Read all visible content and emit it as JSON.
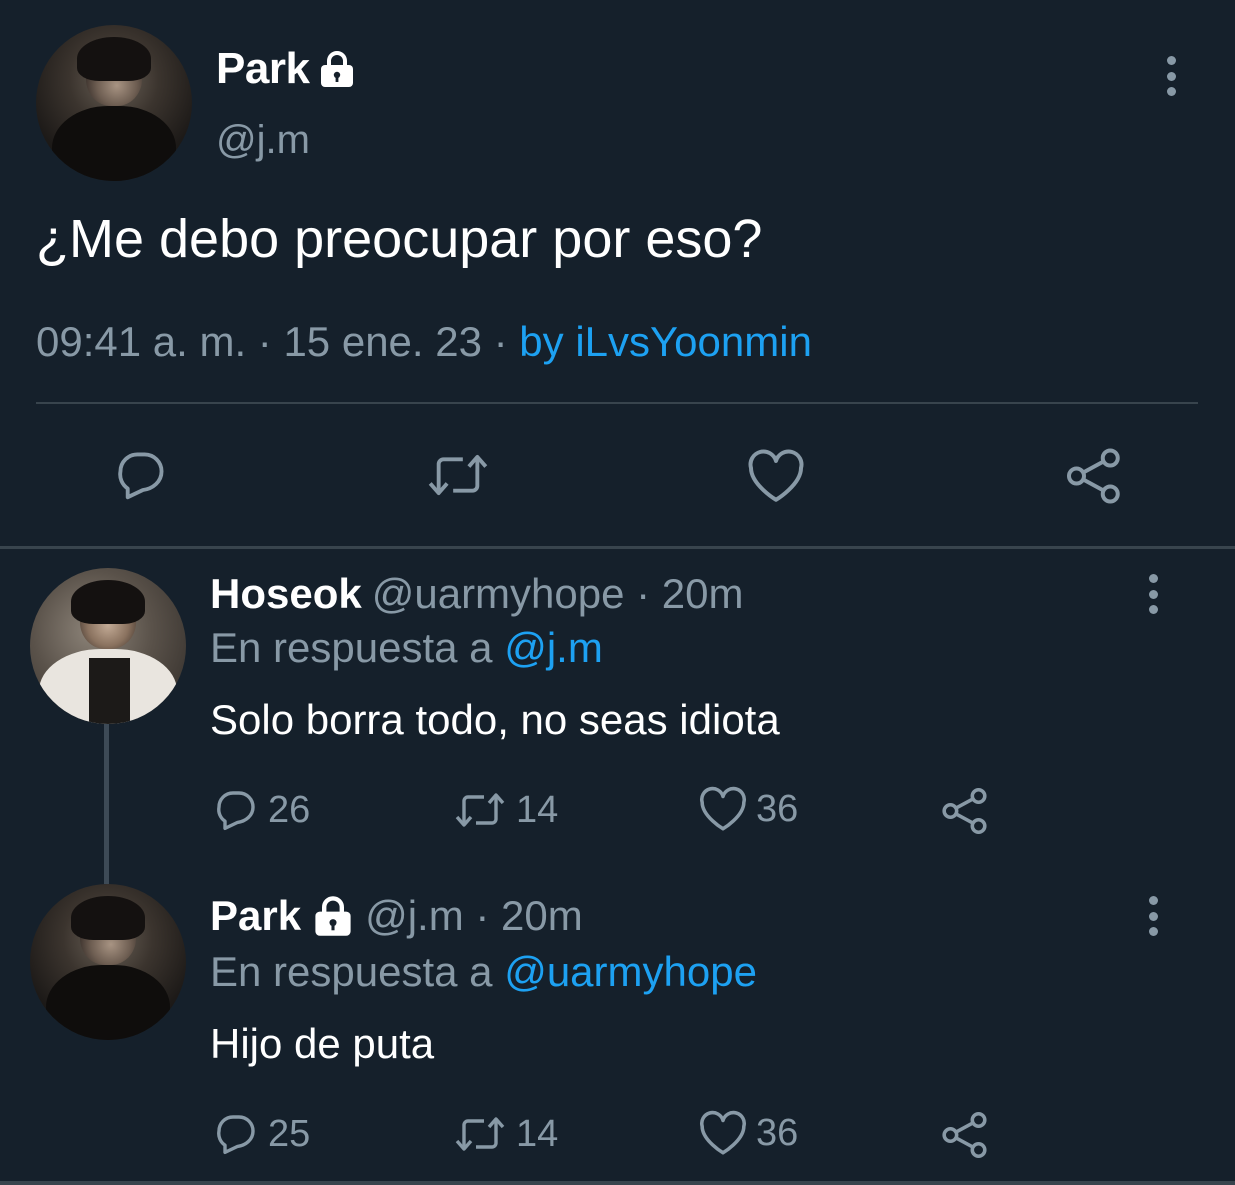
{
  "main_tweet": {
    "author_name": "Park",
    "author_handle": "@j.m",
    "text": "¿Me debo preocupar por eso?",
    "timestamp": "09:41 a. m. · 15 ene. 23 · ",
    "via": "by iLvsYoonmin",
    "locked": true,
    "icons": [
      "reply-icon",
      "retweet-icon",
      "like-icon",
      "share-icon"
    ]
  },
  "replies": [
    {
      "author_name": "Hoseok",
      "author_handle": "@uarmyhope · 20m",
      "reply_prefix": "En respuesta a",
      "reply_to": "@j.m",
      "text": "Solo borra todo, no seas idiota",
      "replies_count": "26",
      "retweets_count": "14",
      "likes_count": "36"
    },
    {
      "author_name": "Park",
      "author_handle": "@j.m · 20m",
      "locked": true,
      "reply_prefix": "En respuesta a",
      "reply_to": "@uarmyhope",
      "text": "Hijo de puta",
      "replies_count": "25",
      "retweets_count": "14",
      "likes_count": "36"
    }
  ],
  "colors": {
    "background": "#15202b",
    "muted": "#8899a6",
    "link": "#1da1f2",
    "divider": "#38444d"
  }
}
